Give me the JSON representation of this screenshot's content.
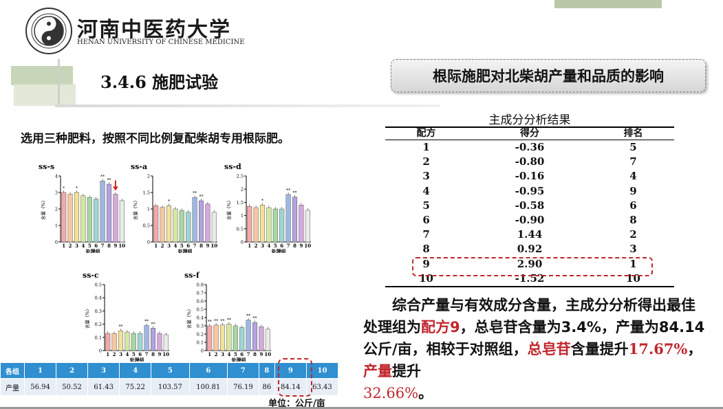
{
  "header": {
    "university_cn": "河南中医药大学",
    "university_en": "HENAN UNIVERSITY OF CHINESE MEDICINE",
    "logo_ring_text": "河南中医药大学",
    "section_title": "3.4.6 施肥试验",
    "topic_box": "根际施肥对北柴胡产量和品质的影响"
  },
  "intro": "选用三种肥料，按照不同比例复配柴胡专用根际肥。",
  "charts": {
    "xlabel": "处理组",
    "ylabel": "含量（%）",
    "ticks_x": [
      "1",
      "2",
      "3",
      "4",
      "5",
      "6",
      "7",
      "8",
      "9",
      "10"
    ],
    "bar_colors": [
      "#f4a9a8",
      "#f6c7a0",
      "#f3e29a",
      "#d6e7a1",
      "#a8d8a5",
      "#9fd6d3",
      "#9fb8e3",
      "#b3a3e0",
      "#d6a8dc",
      "#eaeaea"
    ]
  },
  "chart_data": [
    {
      "type": "bar",
      "title": "ss-s",
      "categories": [
        "1",
        "2",
        "3",
        "4",
        "5",
        "6",
        "7",
        "8",
        "9",
        "10"
      ],
      "values": [
        3.0,
        2.9,
        3.0,
        2.8,
        2.7,
        2.6,
        3.7,
        3.5,
        2.9,
        2.5
      ],
      "labels": [
        "*",
        "",
        "*",
        "",
        "",
        "",
        "**",
        "**",
        "",
        ""
      ],
      "ylim": [
        0,
        4
      ],
      "yticks": [
        0,
        1,
        2,
        3,
        4
      ],
      "xlabel": "处理组",
      "ylabel": "含量（%）",
      "marker_on": "9"
    },
    {
      "type": "bar",
      "title": "ss-a",
      "categories": [
        "1",
        "2",
        "3",
        "4",
        "5",
        "6",
        "7",
        "8",
        "9",
        "10"
      ],
      "values": [
        1.1,
        1.05,
        1.1,
        1.0,
        0.95,
        0.9,
        1.35,
        1.25,
        1.15,
        0.9
      ],
      "labels": [
        "",
        "",
        "*",
        "",
        "",
        "",
        "**",
        "**",
        "",
        ""
      ],
      "ylim": [
        0,
        2
      ],
      "yticks": [
        0,
        0.5,
        1.0,
        1.5,
        2.0
      ],
      "xlabel": "处理组",
      "ylabel": "含量（%）"
    },
    {
      "type": "bar",
      "title": "ss-d",
      "categories": [
        "1",
        "2",
        "3",
        "4",
        "5",
        "6",
        "7",
        "8",
        "9",
        "10"
      ],
      "values": [
        1.35,
        1.3,
        1.4,
        1.3,
        1.25,
        1.25,
        1.8,
        1.7,
        1.4,
        1.2
      ],
      "labels": [
        "",
        "",
        "*",
        "",
        "",
        "",
        "**",
        "**",
        "",
        ""
      ],
      "ylim": [
        0,
        2.5
      ],
      "yticks": [
        0,
        0.5,
        1.0,
        1.5,
        2.0,
        2.5
      ],
      "xlabel": "处理组",
      "ylabel": "含量（%）"
    },
    {
      "type": "bar",
      "title": "ss-c",
      "categories": [
        "1",
        "2",
        "3",
        "4",
        "5",
        "6",
        "7",
        "8",
        "9",
        "10"
      ],
      "values": [
        0.13,
        0.13,
        0.15,
        0.14,
        0.13,
        0.13,
        0.19,
        0.17,
        0.13,
        0.12
      ],
      "labels": [
        "",
        "",
        "**",
        "",
        "",
        "",
        "**",
        "**",
        "",
        ""
      ],
      "ylim": [
        0,
        0.5
      ],
      "yticks": [
        0,
        0.1,
        0.2,
        0.3,
        0.4,
        0.5
      ],
      "xlabel": "处理组",
      "ylabel": "含量（%）"
    },
    {
      "type": "bar",
      "title": "ss-f",
      "categories": [
        "1",
        "2",
        "3",
        "4",
        "5",
        "6",
        "7",
        "8",
        "9",
        "10"
      ],
      "values": [
        0.3,
        0.31,
        0.31,
        0.32,
        0.3,
        0.28,
        0.37,
        0.34,
        0.29,
        0.26
      ],
      "labels": [
        "**",
        "**",
        "**",
        "**",
        "",
        "",
        "**",
        "**",
        "",
        ""
      ],
      "ylim": [
        0,
        0.8
      ],
      "yticks": [
        0,
        0.1,
        0.2,
        0.3,
        0.4,
        0.5,
        0.6,
        0.7,
        0.8
      ],
      "xlabel": "处理组",
      "ylabel": "含量（%）"
    }
  ],
  "pca": {
    "title": "主成分分析结果",
    "headers": [
      "配方",
      "得分",
      "排名"
    ],
    "rows": [
      [
        "1",
        "-0.36",
        "5"
      ],
      [
        "2",
        "-0.80",
        "7"
      ],
      [
        "3",
        "-0.16",
        "4"
      ],
      [
        "4",
        "-0.95",
        "9"
      ],
      [
        "5",
        "-0.58",
        "6"
      ],
      [
        "6",
        "-0.90",
        "8"
      ],
      [
        "7",
        "1.44",
        "2"
      ],
      [
        "8",
        "0.92",
        "3"
      ],
      [
        "9",
        "2.90",
        "1"
      ],
      [
        "10",
        "-1.52",
        "10"
      ]
    ]
  },
  "yield": {
    "headers": [
      "各组",
      "1",
      "2",
      "3",
      "4",
      "5",
      "6",
      "7",
      "8",
      "9",
      "10"
    ],
    "row_label": "产量",
    "values": [
      "56.94",
      "50.52",
      "61.43",
      "75.22",
      "103.57",
      "100.81",
      "76.19",
      "86",
      "84.14",
      "63.43"
    ],
    "unit": "单位：公斤/亩"
  },
  "summary": {
    "p1": "综合产量与有效成分含量，主成分分析得出最佳处理组为",
    "r1": "配方9",
    "p2": "，总皂苷含量为3.4%，产量为84.14公斤/亩，相较于对照组，",
    "r2": "总皂苷",
    "p3": "含量提升",
    "r3": "17.67%",
    "p4": "，",
    "r4": "产量",
    "p5": "提升",
    "r5": "32.66%",
    "p6": "。"
  },
  "colors": {
    "accent_red": "#c0262d",
    "table_blue": "#2f8fd0",
    "table_cell": "#e7eef6"
  }
}
